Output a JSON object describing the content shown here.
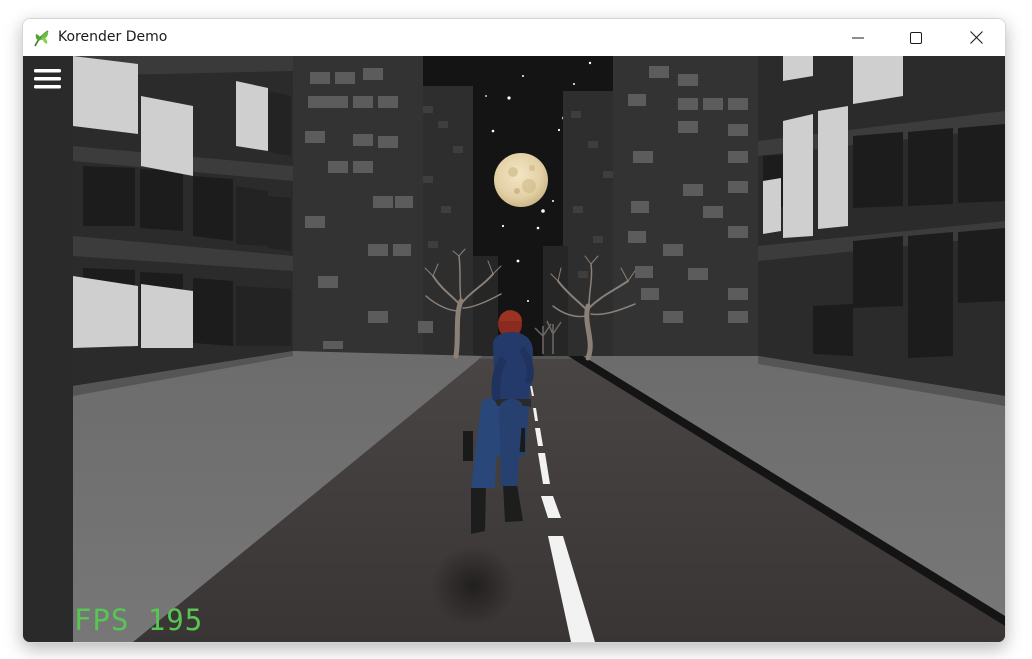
{
  "window": {
    "title": "Korender Demo",
    "icon": "leaf-icon",
    "controls": {
      "minimize": "minimize-icon",
      "maximize": "maximize-icon",
      "close": "close-icon"
    }
  },
  "sidebar": {
    "menu_icon": "hamburger-menu-icon"
  },
  "hud": {
    "fps_label": "FPS 195"
  },
  "colors": {
    "fps_text": "#57c653",
    "sidebar_bg": "#2a2a2a",
    "sky": "#141414",
    "road": "#3e3a3a",
    "sidewalk": "#6f6f6f",
    "moon": "#e8d9b4"
  }
}
